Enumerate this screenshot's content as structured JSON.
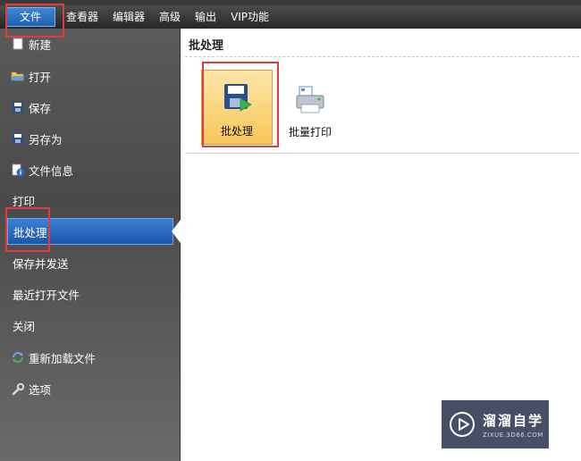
{
  "menubar": {
    "items": [
      "文件",
      "查看器",
      "编辑器",
      "高级",
      "输出",
      "VIP功能"
    ]
  },
  "sidebar": {
    "items": [
      {
        "label": "新建",
        "icon": "new-icon"
      },
      {
        "label": "打开",
        "icon": "folder-open-icon"
      },
      {
        "label": "保存",
        "icon": "save-icon"
      },
      {
        "label": "另存为",
        "icon": "save-as-icon"
      },
      {
        "label": "文件信息",
        "icon": "file-info-icon"
      },
      {
        "label": "打印",
        "icon": ""
      },
      {
        "label": "批处理",
        "icon": "",
        "active": true
      },
      {
        "label": "保存并发送",
        "icon": ""
      },
      {
        "label": "最近打开文件",
        "icon": ""
      },
      {
        "label": "关闭",
        "icon": ""
      },
      {
        "label": "重新加载文件",
        "icon": "reload-icon"
      },
      {
        "label": "选项",
        "icon": "wrench-icon"
      }
    ]
  },
  "main": {
    "section_title": "批处理",
    "tiles": [
      {
        "label": "批处理",
        "icon": "batch-process-icon",
        "selected": true
      },
      {
        "label": "批量打印",
        "icon": "batch-print-icon",
        "selected": false
      }
    ]
  },
  "watermark": {
    "main_text": "溜溜自学",
    "sub_text": "ZIXUE.3D66.COM"
  },
  "colors": {
    "menubar": "#2f2f2f",
    "file_tab": "#2a6cc0",
    "sidebar": "#555555",
    "active_item": "#2d6cc4",
    "selected_tile": "#f9cf6a",
    "highlight_red": "#e23b3b"
  }
}
